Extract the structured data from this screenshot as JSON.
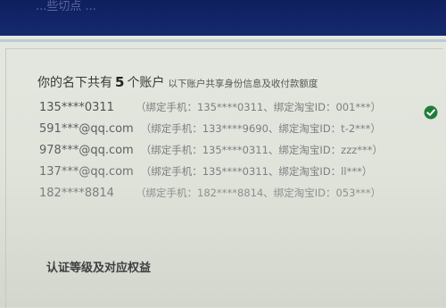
{
  "header": {
    "faint_title": "...些切点  ..."
  },
  "summary": {
    "prefix": "你的名下共有",
    "count": "5",
    "suffix": "个账户",
    "hint": "以下账户共享身份信息及收付款额度"
  },
  "accounts": [
    {
      "account": "135****0311",
      "detail": "（绑定手机：135****0311、绑定淘宝ID：001***）",
      "selected": true
    },
    {
      "account": "591***@qq.com",
      "detail": "（绑定手机：133****9690、绑定淘宝ID：t-2***）",
      "selected": false
    },
    {
      "account": "978***@qq.com",
      "detail": "（绑定手机：135****0311、绑定淘宝ID：zzz***）",
      "selected": false
    },
    {
      "account": "137***@qq.com",
      "detail": "（绑定手机：135****0311、绑定淘宝ID：ll***）",
      "selected": false
    },
    {
      "account": "182****8814",
      "detail": "（绑定手机：182****8814、绑定淘宝ID：053***）",
      "selected": false
    }
  ],
  "section": {
    "title": "认证等级及对应权益"
  },
  "colors": {
    "header_bg": "#15296e",
    "check_green": "#1e7d3a"
  },
  "icons": {
    "selected": "check-circle-icon"
  }
}
